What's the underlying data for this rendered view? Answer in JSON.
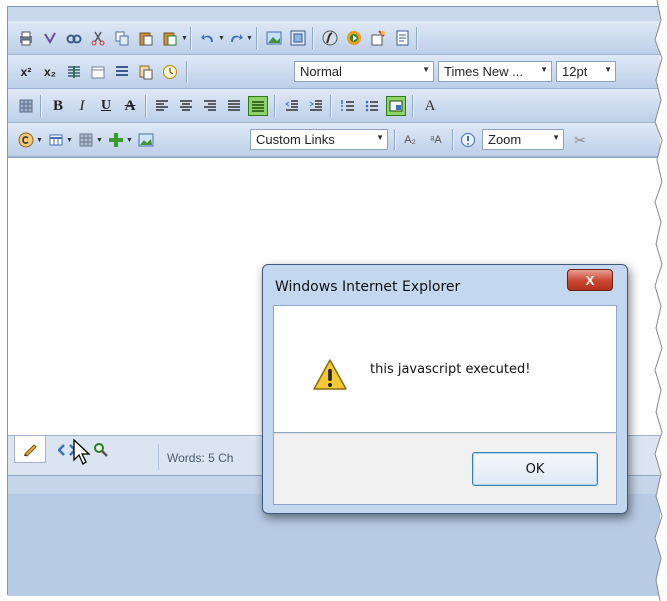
{
  "toolbar": {
    "row1": [
      "print-icon",
      "spellcheck-icon",
      "find-icon",
      "cut-icon",
      "copy-icon",
      "paste-icon",
      "paste-special-icon",
      "undo-icon",
      "redo-icon",
      "image-manager-icon",
      "image-map-icon",
      "flash-icon",
      "media-icon",
      "insert-symbol-icon",
      "template-icon"
    ],
    "row2": {
      "paragraph_style": "Normal",
      "font_name": "Times New ...",
      "font_size": "12pt"
    },
    "row3": {
      "bold_label": "B",
      "italic_label": "I",
      "underline_label": "U",
      "strike_label": "A",
      "last_label": "A"
    },
    "row4": {
      "custom_links": "Custom Links",
      "zoom": "Zoom"
    }
  },
  "status": {
    "words": "Words: 5 Ch"
  },
  "dialog": {
    "title": "Windows Internet Explorer",
    "close_label": "X",
    "message": "this javascript executed!",
    "ok_label": "OK"
  },
  "colors": {
    "toolbar_bg": "#c9d8ec",
    "active_button": "#8ed26a",
    "dialog_frame": "#c3d8ef",
    "close_button": "#c9452f"
  }
}
